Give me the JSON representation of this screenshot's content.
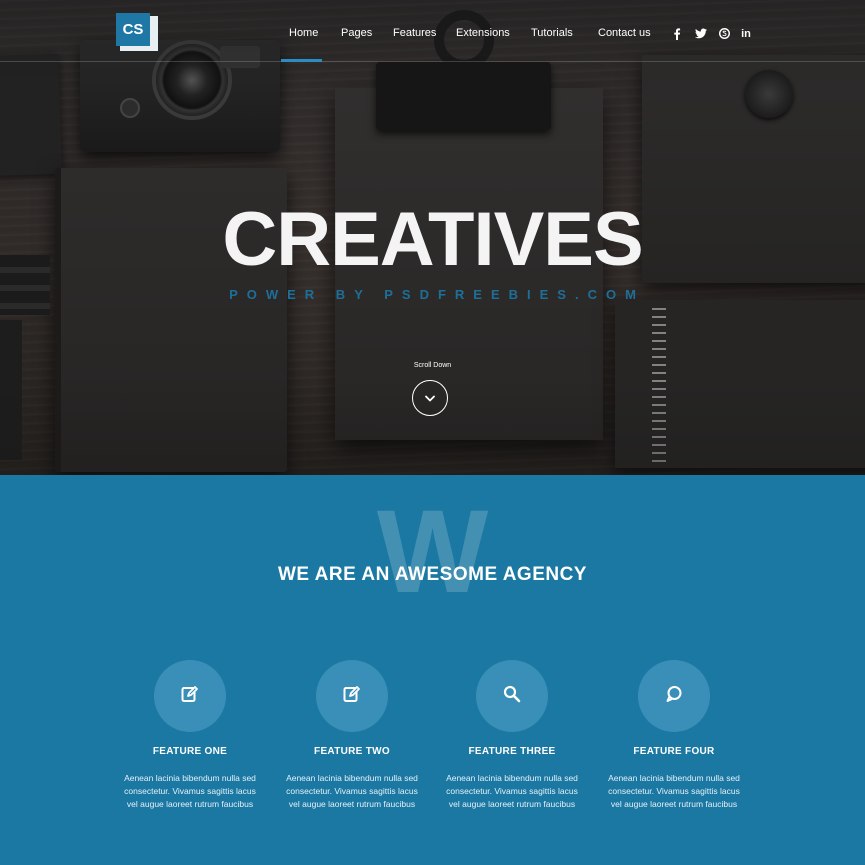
{
  "brand": {
    "logo_text": "CS"
  },
  "nav": {
    "items": [
      {
        "label": "Home"
      },
      {
        "label": "Pages"
      },
      {
        "label": "Features"
      },
      {
        "label": "Extensions"
      },
      {
        "label": "Tutorials"
      },
      {
        "label": "Contact us"
      }
    ],
    "active": "Home",
    "social": [
      {
        "icon": "facebook-icon",
        "glyph": "f"
      },
      {
        "icon": "twitter-icon",
        "glyph": "t"
      },
      {
        "icon": "skype-icon",
        "glyph": "s"
      },
      {
        "icon": "linkedin-icon",
        "glyph": "in"
      }
    ]
  },
  "hero": {
    "title": "CREATIVES",
    "subtitle": "POWER BY PSDFREEBIES.COM",
    "scroll_label": "Scroll Down"
  },
  "agency": {
    "watermark": "W",
    "title": "WE ARE AN AWESOME AGENCY",
    "features": [
      {
        "icon": "edit-icon",
        "title": "FEATURE ONE",
        "desc_lines": [
          "Aenean lacinia bibendum nulla sed",
          "consectetur. Vivamus sagittis lacus",
          "vel augue laoreet rutrum faucibus"
        ]
      },
      {
        "icon": "edit-icon",
        "title": "FEATURE TWO",
        "desc_lines": [
          "Aenean lacinia bibendum nulla sed",
          "consectetur. Vivamus sagittis lacus",
          "vel augue laoreet rutrum faucibus"
        ]
      },
      {
        "icon": "search-icon",
        "title": "FEATURE THREE",
        "desc_lines": [
          "Aenean lacinia bibendum nulla sed",
          "consectetur. Vivamus sagittis lacus",
          "vel augue laoreet rutrum faucibus"
        ]
      },
      {
        "icon": "chat-bubble-icon",
        "title": "FEATURE FOUR",
        "desc_lines": [
          "Aenean lacinia bibendum nulla sed",
          "consectetur. Vivamus sagittis lacus",
          "vel augue laoreet rutrum faucibus"
        ]
      }
    ]
  },
  "colors": {
    "accent": "#1f77a6",
    "section_bg": "#1a78a3",
    "feature_circle": "#3a8fb8",
    "hero_bg": "#2d2a2a"
  }
}
